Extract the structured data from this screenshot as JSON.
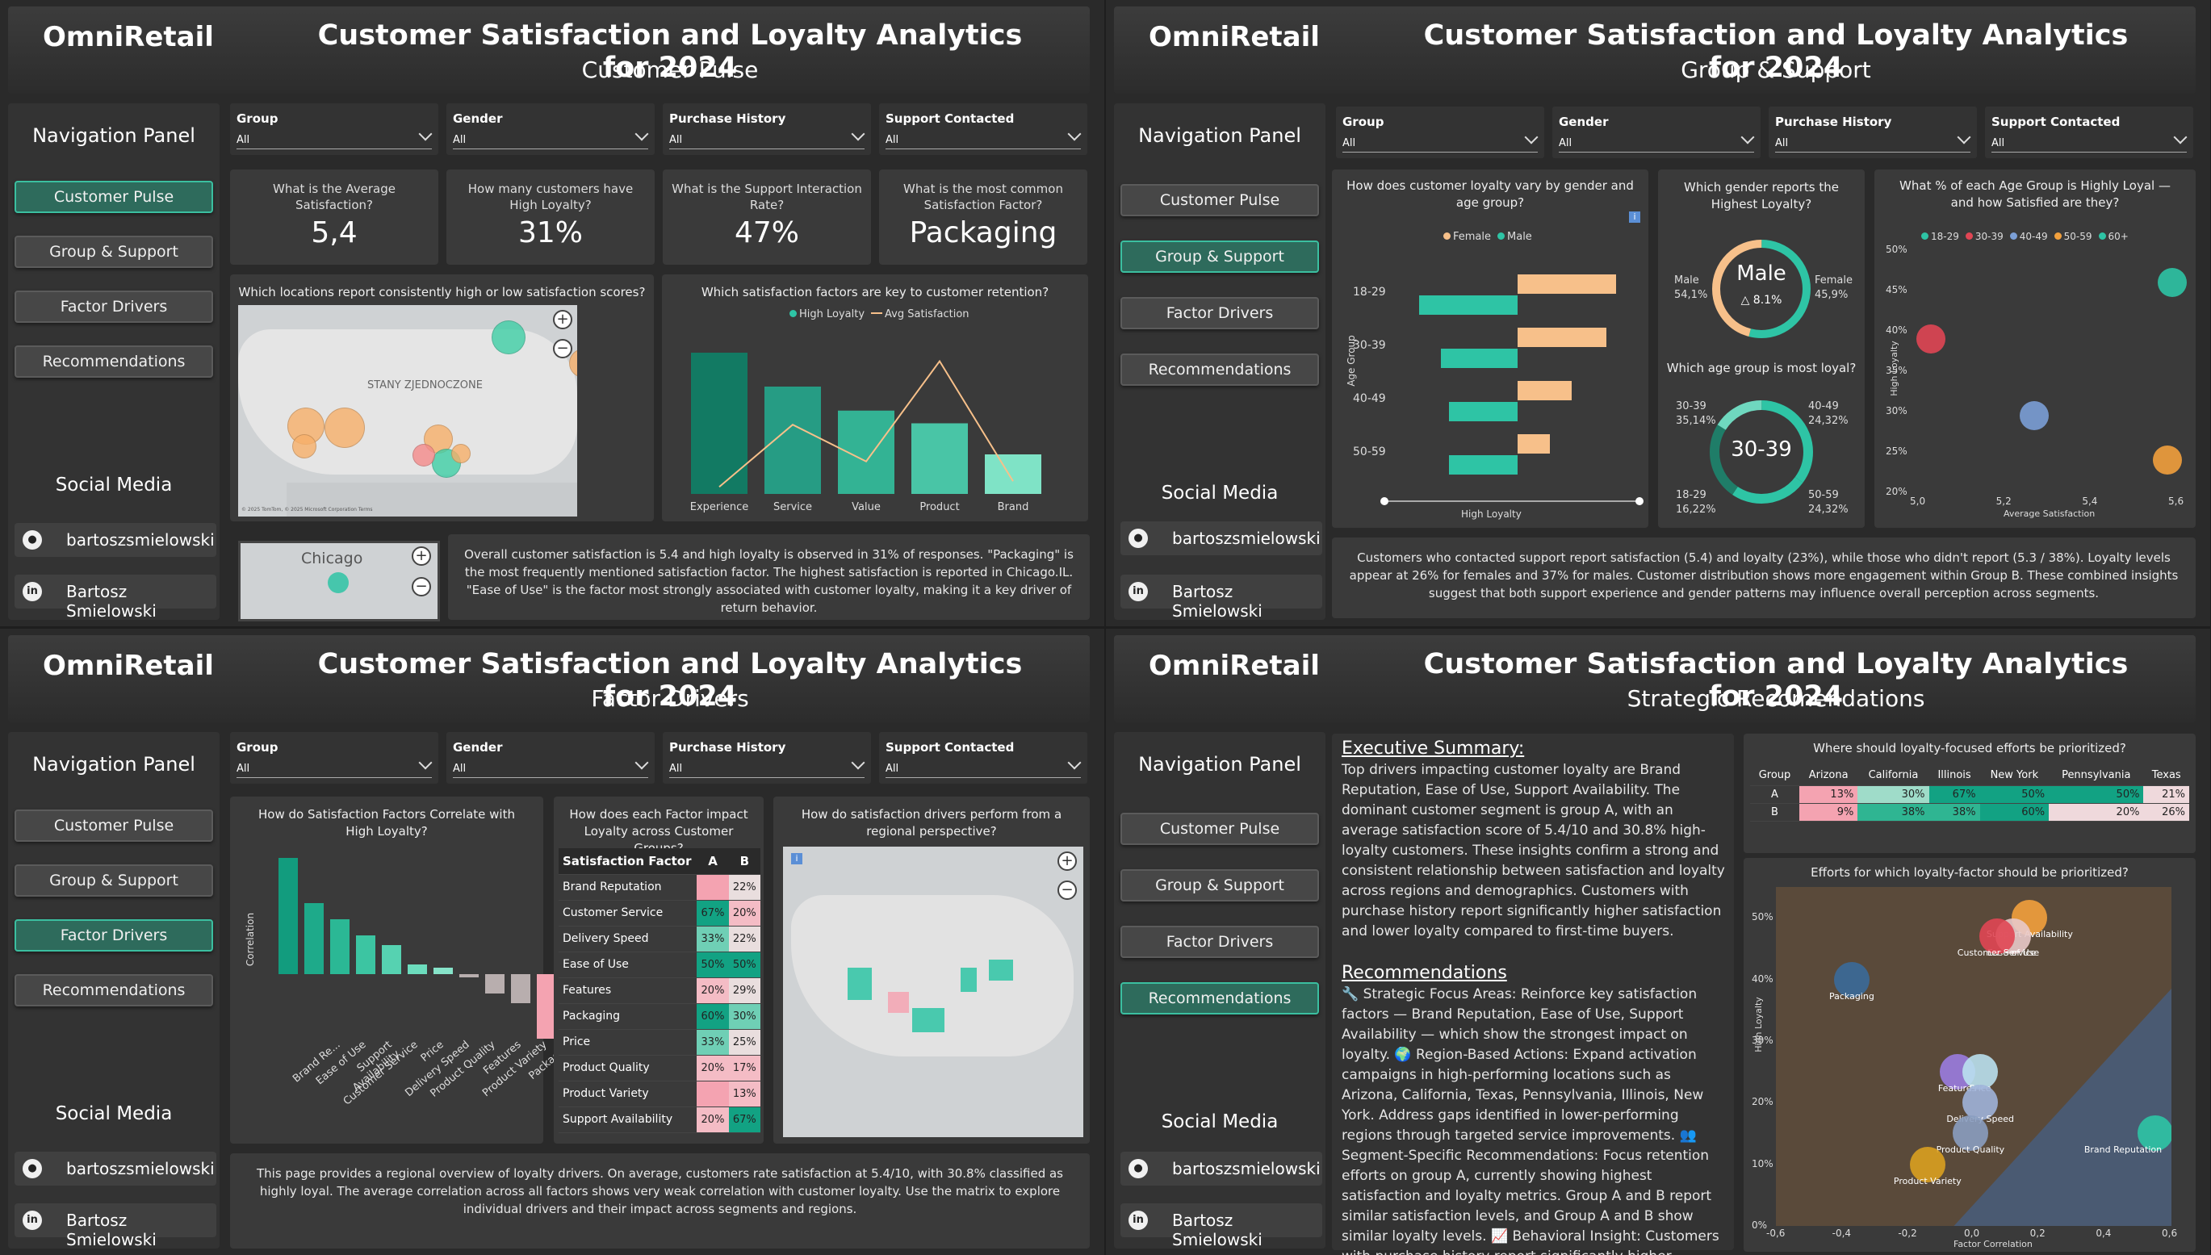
{
  "brand": "OmniRetail",
  "title": "Customer Satisfaction and Loyalty Analytics for 2024",
  "subtitles": {
    "q1": "Customer Pulse",
    "q2": "Group & Support",
    "q3": "Factor Drivers",
    "q4": "Strategic Recomendations"
  },
  "nav": {
    "title": "Navigation Panel",
    "items": [
      "Customer Pulse",
      "Group & Support",
      "Factor Drivers",
      "Recommendations"
    ],
    "social_title": "Social Media",
    "github": "bartoszsmielowski",
    "linkedin": "Bartosz Smielowski"
  },
  "slicers": [
    {
      "label": "Group",
      "value": "All"
    },
    {
      "label": "Gender",
      "value": "All"
    },
    {
      "label": "Purchase History",
      "value": "All"
    },
    {
      "label": "Support Contacted",
      "value": "All"
    }
  ],
  "kpis": [
    {
      "question": "What is the Average Satisfaction?",
      "value": "5,4"
    },
    {
      "question": "How many customers have High Loyalty?",
      "value": "31%"
    },
    {
      "question": "What is the Support Interaction Rate?",
      "value": "47%"
    },
    {
      "question": "What is the most common Satisfaction Factor?",
      "value": "Packaging"
    }
  ],
  "pulse": {
    "map_title": "Which locations report consistently high or low satisfaction scores?",
    "map_label": "STANY ZJEDNOCZONE",
    "chicago": "Chicago",
    "chart_title": "Which satisfaction factors are key to customer retention?",
    "legend": [
      "High Loyalty",
      "Avg Satisfaction"
    ],
    "summary": "Overall customer satisfaction is 5.4 and high loyalty is observed in 31% of responses. \"Packaging\" is the most frequently mentioned satisfaction factor. The highest satisfaction is reported in Chicago.IL. \"Ease of Use\" is the factor most strongly associated with customer loyalty, making it a key driver of return behavior.",
    "map_credit": "© 2025 TomTom, © 2025 Microsoft Corporation Terms"
  },
  "group": {
    "q_gender_age": "How does customer loyalty vary by gender and age group?",
    "gender_legend": [
      "Female",
      "Male"
    ],
    "age_groups": [
      "18-29",
      "30-39",
      "40-49",
      "50-59"
    ],
    "age_axis": "Age Group",
    "loyalty_axis": "High Loyalty",
    "q_gender": "Which gender reports the Highest Loyalty?",
    "gender_center": "Male",
    "gender_delta": "△ 8.1%",
    "gender_male": "Male",
    "gender_male_pct": "54,1%",
    "gender_female": "Female",
    "gender_female_pct": "45,9%",
    "q_age": "Which age group is most loyal?",
    "age_center": "30-39",
    "age_labels": [
      {
        "label": "30-39",
        "pct": "35,14%"
      },
      {
        "label": "40-49",
        "pct": "24,32%"
      },
      {
        "label": "18-29",
        "pct": "16,22%"
      },
      {
        "label": "50-59",
        "pct": "24,32%"
      }
    ],
    "q_scatter": "What % of each Age Group is Highly Loyal — and how Satisfied are they?",
    "scatter_legend": [
      "18-29",
      "30-39",
      "40-49",
      "50-59",
      "60+"
    ],
    "scatter_ylabel": "High Loyalty",
    "scatter_xlabel": "Average Satisfaction",
    "summary": "Customers who contacted support report satisfaction (5.4) and loyalty (23%), while those who didn't report (5.3 / 38%). Loyalty levels appear at 26% for females and 37% for males. Customer distribution shows more engagement within Group B. These combined insights suggest that both support experience and gender patterns may influence overall perception across segments."
  },
  "factors": {
    "q_corr": "How do Satisfaction Factors Correlate with High Loyalty?",
    "corr_ylabel": "Correlation",
    "q_matrix": "How does each Factor impact Loyalty across Customer Groups?",
    "matrix_headers": [
      "Satisfaction Factor",
      "A",
      "B"
    ],
    "q_map": "How do satisfaction drivers perform from a regional perspective?",
    "summary": "This page provides a regional overview of loyalty drivers. On average, customers rate satisfaction at 5.4/10, with 30.8% classified as highly loyal. The average correlation across all factors shows very weak correlation with customer loyalty. Use the matrix to explore individual drivers and their impact across segments and regions."
  },
  "matrix_rows": [
    {
      "factor": "Brand Reputation",
      "a": "",
      "b": "22%"
    },
    {
      "factor": "Customer Service",
      "a": "67%",
      "b": "20%"
    },
    {
      "factor": "Delivery Speed",
      "a": "33%",
      "b": "22%"
    },
    {
      "factor": "Ease of Use",
      "a": "50%",
      "b": "50%"
    },
    {
      "factor": "Features",
      "a": "20%",
      "b": "29%"
    },
    {
      "factor": "Packaging",
      "a": "60%",
      "b": "30%"
    },
    {
      "factor": "Price",
      "a": "33%",
      "b": "25%"
    },
    {
      "factor": "Product Quality",
      "a": "20%",
      "b": "17%"
    },
    {
      "factor": "Product Variety",
      "a": "",
      "b": "13%"
    },
    {
      "factor": "Support Availability",
      "a": "20%",
      "b": "67%"
    }
  ],
  "recs": {
    "exec_title": "Executive Summary:",
    "exec_text": "Top drivers impacting customer loyalty are Brand Reputation, Ease of Use, Support Availability. The dominant customer segment is group A, with an average satisfaction score of 5.4/10 and 30.8% high-loyalty customers. These insights confirm a strong and consistent relationship between satisfaction and loyalty across regions and demographics. Customers with purchase history report significantly higher satisfaction and lower loyalty compared to first-time buyers.",
    "rec_title": "Recommendations",
    "rec_text": "🔧 Strategic Focus Areas: Reinforce key satisfaction factors — Brand Reputation, Ease of Use, Support Availability — which show the strongest impact on loyalty. 🌍 Region-Based Actions: Expand activation campaigns in high-performing locations such as Arizona, California, Texas, Pennsylvania, Illinois, New York. Address gaps identified in lower-performing regions through targeted service improvements. 👥 Segment-Specific Recommendations: Focus retention efforts on group A, currently showing highest satisfaction and loyalty metrics. Group A and B report similar satisfaction levels, and Group A and B show similar loyalty levels. 📈 Behavioral Insight: Customers with purchase history report significantly higher satisfaction and lower loyalty compared to first-time buyers.",
    "q_states": "Where should loyalty-focused efforts be prioritized?",
    "state_headers": [
      "Group",
      "Arizona",
      "California",
      "Illinois",
      "New York",
      "Pennsylvania",
      "Texas"
    ],
    "state_rows": [
      {
        "group": "A",
        "values": [
          "13%",
          "30%",
          "67%",
          "50%",
          "50%",
          "21%"
        ]
      },
      {
        "group": "B",
        "values": [
          "9%",
          "38%",
          "38%",
          "60%",
          "20%",
          "26%"
        ]
      }
    ],
    "q_quadrant": "Efforts for which loyalty-factor should be prioritized?",
    "quad_ylabel": "High Loyalty",
    "quad_xlabel": "Factor Correlation"
  },
  "chart_data": [
    {
      "type": "bar",
      "title": "Which satisfaction factors are key to customer retention?",
      "categories": [
        "Experience",
        "Service",
        "Value",
        "Product",
        "Brand"
      ],
      "series": [
        {
          "name": "High Loyalty",
          "values": [
            100,
            76,
            59,
            50,
            28
          ]
        },
        {
          "name": "Avg Satisfaction",
          "values": [
            5,
            49,
            23,
            94,
            9
          ]
        }
      ]
    },
    {
      "type": "bar",
      "title": "How does customer loyalty vary by gender and age group?",
      "categories": [
        "18-29",
        "30-39",
        "40-49",
        "50-59"
      ],
      "series": [
        {
          "name": "Female",
          "values": [
            100,
            90,
            55,
            33
          ]
        },
        {
          "name": "Male",
          "values": [
            -100,
            -78,
            -70,
            -70
          ]
        }
      ]
    },
    {
      "type": "pie",
      "title": "Which gender reports the Highest Loyalty?",
      "categories": [
        "Male",
        "Female"
      ],
      "values": [
        54.1,
        45.9
      ]
    },
    {
      "type": "pie",
      "title": "Which age group is most loyal?",
      "categories": [
        "30-39",
        "40-49",
        "50-59",
        "18-29"
      ],
      "values": [
        35.14,
        24.32,
        24.32,
        16.22
      ]
    },
    {
      "type": "scatter",
      "title": "What % of each Age Group is Highly Loyal — and how Satisfied are they?",
      "xlabel": "Average Satisfaction",
      "ylabel": "High Loyalty",
      "xlim": [
        5.0,
        5.6
      ],
      "ylim": [
        20,
        50
      ],
      "x_ticks": [
        "5,0",
        "5,2",
        "5,4",
        "5,6"
      ],
      "y_ticks": [
        "20%",
        "25%",
        "30%",
        "35%",
        "40%",
        "45%",
        "50%"
      ],
      "series": [
        {
          "name": "18-29",
          "x": 5.03,
          "y": 39
        },
        {
          "name": "40-49",
          "x": 5.27,
          "y": 29.5
        },
        {
          "name": "50-59",
          "x": 5.58,
          "y": 24
        },
        {
          "name": "60+",
          "x": 5.59,
          "y": 46
        }
      ]
    },
    {
      "type": "bar",
      "title": "How do Satisfaction Factors Correlate with High Loyalty?",
      "ylabel": "Correlation",
      "categories": [
        "Brand Re...",
        "Ease of Use",
        "Support Availability",
        "Customer Service",
        "Price",
        "Delivery Speed",
        "Product Quality",
        "Features",
        "Product Variety",
        "Packaging"
      ],
      "values": [
        0.36,
        0.22,
        0.17,
        0.12,
        0.09,
        0.03,
        0.02,
        -0.01,
        -0.06,
        -0.09,
        -0.2
      ]
    },
    {
      "type": "scatter",
      "title": "Efforts for which loyalty-factor should be prioritized?",
      "xlabel": "Factor Correlation",
      "ylabel": "High Loyalty",
      "xlim": [
        -0.6,
        0.6
      ],
      "ylim": [
        0,
        55
      ],
      "x_ticks": [
        "-0,6",
        "-0,4",
        "-0,2",
        "0,0",
        "0,2",
        "0,4",
        "0,6"
      ],
      "y_ticks": [
        "0%",
        "10%",
        "20%",
        "30%",
        "40%",
        "50%"
      ],
      "points": [
        {
          "label": "Support Availability",
          "x": 0.17,
          "y": 50
        },
        {
          "label": "Ease of Use",
          "x": 0.12,
          "y": 47
        },
        {
          "label": "Customer Service",
          "x": 0.07,
          "y": 47
        },
        {
          "label": "Packaging",
          "x": -0.37,
          "y": 40
        },
        {
          "label": "Features",
          "x": -0.05,
          "y": 25
        },
        {
          "label": "Price",
          "x": 0.02,
          "y": 25
        },
        {
          "label": "Delivery Speed",
          "x": 0.02,
          "y": 20
        },
        {
          "label": "Product Quality",
          "x": -0.01,
          "y": 15
        },
        {
          "label": "Brand Reputation",
          "x": 0.55,
          "y": 15
        },
        {
          "label": "Product Variety",
          "x": -0.14,
          "y": 10
        }
      ]
    }
  ],
  "colors": {
    "teal": "#2ec4a5",
    "dark_teal": "#127a63",
    "peach": "#f7c08a",
    "pink": "#f4a3b1",
    "red": "#e04654",
    "blue": "#7b9fd6",
    "orange": "#f2a03d",
    "purple": "#9a7ce0"
  }
}
